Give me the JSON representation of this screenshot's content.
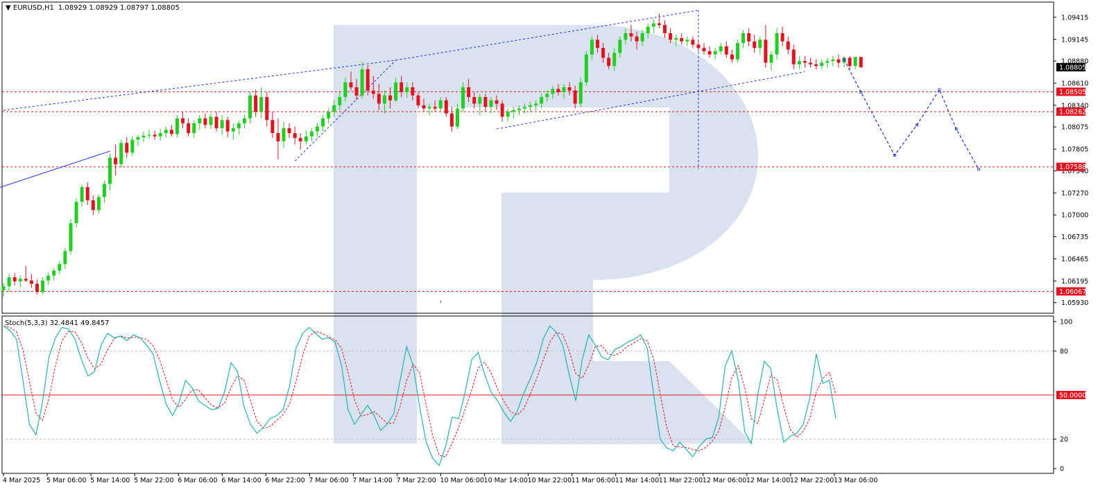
{
  "chart_data": {
    "type": "candlestick",
    "header": {
      "symbol": "EURUSD,H1",
      "values": "1.08929 1.08929 1.08797 1.08805"
    },
    "price_axis": {
      "ylim": [
        1.058,
        1.096
      ],
      "ticks": [
        "1.09415",
        "1.09145",
        "1.08880",
        "1.08610",
        "1.08340",
        "1.08075",
        "1.07805",
        "1.07540",
        "1.07270",
        "1.07000",
        "1.06735",
        "1.06465",
        "1.06195",
        "1.05930"
      ],
      "levels": [
        {
          "price": 1.08805,
          "label": "1.08805",
          "kind": "current"
        },
        {
          "price": 1.08505,
          "label": "1.08505",
          "kind": "level"
        },
        {
          "price": 1.08262,
          "label": "1.08262",
          "kind": "level"
        },
        {
          "price": 1.07588,
          "label": "1.07588",
          "kind": "level"
        },
        {
          "price": 1.06067,
          "label": "1.06067",
          "kind": "level"
        }
      ]
    },
    "time_axis": {
      "labels": [
        "4 Mar 2025",
        "5 Mar 06:00",
        "5 Mar 14:00",
        "5 Mar 22:00",
        "6 Mar 06:00",
        "6 Mar 14:00",
        "6 Mar 22:00",
        "7 Mar 06:00",
        "7 Mar 14:00",
        "7 Mar 22:00",
        "10 Mar 06:00",
        "10 Mar 14:00",
        "10 Mar 22:00",
        "11 Mar 06:00",
        "11 Mar 14:00",
        "11 Mar 22:00",
        "12 Mar 06:00",
        "12 Mar 14:00",
        "12 Mar 22:00",
        "13 Mar 06:00"
      ]
    },
    "candles": [
      [
        1.0608,
        1.0617,
        1.06,
        1.0613
      ],
      [
        1.0613,
        1.0628,
        1.0606,
        1.0624
      ],
      [
        1.0624,
        1.0629,
        1.0614,
        1.0619
      ],
      [
        1.0619,
        1.0626,
        1.0612,
        1.0622
      ],
      [
        1.0622,
        1.0638,
        1.0618,
        1.062
      ],
      [
        1.062,
        1.0628,
        1.0611,
        1.0616
      ],
      [
        1.0616,
        1.0621,
        1.0603,
        1.0606
      ],
      [
        1.0606,
        1.0624,
        1.0603,
        1.062
      ],
      [
        1.062,
        1.063,
        1.0615,
        1.0626
      ],
      [
        1.0626,
        1.0635,
        1.062,
        1.0632
      ],
      [
        1.0632,
        1.0644,
        1.0628,
        1.064
      ],
      [
        1.064,
        1.066,
        1.0634,
        1.0656
      ],
      [
        1.0656,
        1.0695,
        1.0652,
        1.069
      ],
      [
        1.069,
        1.072,
        1.0685,
        1.0716
      ],
      [
        1.0716,
        1.0737,
        1.071,
        1.0734
      ],
      [
        1.0734,
        1.074,
        1.0712,
        1.0718
      ],
      [
        1.0718,
        1.0724,
        1.07,
        1.0706
      ],
      [
        1.0706,
        1.0725,
        1.0702,
        1.0722
      ],
      [
        1.0722,
        1.0742,
        1.0715,
        1.0738
      ],
      [
        1.0738,
        1.0775,
        1.073,
        1.077
      ],
      [
        1.077,
        1.0786,
        1.0748,
        1.0762
      ],
      [
        1.0762,
        1.0792,
        1.0758,
        1.0788
      ],
      [
        1.0788,
        1.0795,
        1.077,
        1.0776
      ],
      [
        1.0776,
        1.0796,
        1.0772,
        1.0792
      ],
      [
        1.0792,
        1.0798,
        1.0784,
        1.0795
      ],
      [
        1.0795,
        1.0802,
        1.0789,
        1.0797
      ],
      [
        1.0797,
        1.0804,
        1.0793,
        1.0798
      ],
      [
        1.0798,
        1.0803,
        1.0792,
        1.0796
      ],
      [
        1.0796,
        1.0805,
        1.0791,
        1.08
      ],
      [
        1.08,
        1.0808,
        1.0795,
        1.0804
      ],
      [
        1.0804,
        1.081,
        1.0796,
        1.0799
      ],
      [
        1.0799,
        1.0822,
        1.0795,
        1.0818
      ],
      [
        1.0818,
        1.0826,
        1.0806,
        1.0812
      ],
      [
        1.0812,
        1.0818,
        1.0796,
        1.08
      ],
      [
        1.08,
        1.0816,
        1.0794,
        1.0812
      ],
      [
        1.0812,
        1.0822,
        1.0804,
        1.0818
      ],
      [
        1.0818,
        1.0824,
        1.0806,
        1.081
      ],
      [
        1.081,
        1.0824,
        1.0805,
        1.082
      ],
      [
        1.082,
        1.0826,
        1.0802,
        1.0806
      ],
      [
        1.0806,
        1.0822,
        1.0798,
        1.0816
      ],
      [
        1.0816,
        1.082,
        1.0795,
        1.0802
      ],
      [
        1.0802,
        1.0812,
        1.0792,
        1.0806
      ],
      [
        1.0806,
        1.0815,
        1.0798,
        1.0812
      ],
      [
        1.0812,
        1.0822,
        1.0806,
        1.0818
      ],
      [
        1.0818,
        1.085,
        1.0812,
        1.0846
      ],
      [
        1.0846,
        1.0853,
        1.082,
        1.0826
      ],
      [
        1.0826,
        1.0856,
        1.0818,
        1.0844
      ],
      [
        1.0844,
        1.085,
        1.0808,
        1.0816
      ],
      [
        1.0816,
        1.0826,
        1.0794,
        1.08
      ],
      [
        1.08,
        1.0818,
        1.0768,
        1.079
      ],
      [
        1.079,
        1.0814,
        1.0782,
        1.0806
      ],
      [
        1.0806,
        1.0812,
        1.0794,
        1.08
      ],
      [
        1.08,
        1.0808,
        1.0786,
        1.0794
      ],
      [
        1.0794,
        1.08,
        1.078,
        1.079
      ],
      [
        1.079,
        1.0803,
        1.0786,
        1.0796
      ],
      [
        1.0796,
        1.0806,
        1.079,
        1.0802
      ],
      [
        1.0802,
        1.0812,
        1.0796,
        1.0808
      ],
      [
        1.0808,
        1.0822,
        1.0802,
        1.0818
      ],
      [
        1.0818,
        1.083,
        1.0812,
        1.0826
      ],
      [
        1.0826,
        1.084,
        1.082,
        1.0834
      ],
      [
        1.0834,
        1.085,
        1.0828,
        1.0844
      ],
      [
        1.0844,
        1.0868,
        1.0838,
        1.0862
      ],
      [
        1.0862,
        1.0875,
        1.0852,
        1.0856
      ],
      [
        1.0856,
        1.0866,
        1.084,
        1.0846
      ],
      [
        1.0846,
        1.0887,
        1.0842,
        1.0878
      ],
      [
        1.0878,
        1.0883,
        1.0846,
        1.0852
      ],
      [
        1.0852,
        1.087,
        1.0842,
        1.0848
      ],
      [
        1.0848,
        1.086,
        1.0828,
        1.0836
      ],
      [
        1.0836,
        1.0852,
        1.0824,
        1.0846
      ],
      [
        1.0846,
        1.0856,
        1.083,
        1.084
      ],
      [
        1.084,
        1.0868,
        1.0838,
        1.0862
      ],
      [
        1.0862,
        1.087,
        1.0844,
        1.085
      ],
      [
        1.085,
        1.0862,
        1.0843,
        1.0856
      ],
      [
        1.0856,
        1.0862,
        1.084,
        1.0846
      ],
      [
        1.0846,
        1.085,
        1.083,
        1.0834
      ],
      [
        1.0834,
        1.0842,
        1.0826,
        1.083
      ],
      [
        1.083,
        1.0836,
        1.0822,
        1.0832
      ],
      [
        1.0832,
        1.084,
        1.0826,
        1.083
      ],
      [
        1.083,
        1.0844,
        1.0826,
        1.084
      ],
      [
        1.084,
        1.0844,
        1.082,
        1.0824
      ],
      [
        1.0824,
        1.0832,
        1.0802,
        1.0808
      ],
      [
        1.0808,
        1.0836,
        1.0805,
        1.083
      ],
      [
        1.083,
        1.0862,
        1.0826,
        1.0856
      ],
      [
        1.0856,
        1.0866,
        1.0838,
        1.0844
      ],
      [
        1.0844,
        1.085,
        1.083,
        1.0836
      ],
      [
        1.0836,
        1.0848,
        1.0822,
        1.0844
      ],
      [
        1.0844,
        1.0848,
        1.0826,
        1.0832
      ],
      [
        1.0832,
        1.0844,
        1.0824,
        1.084
      ],
      [
        1.084,
        1.0846,
        1.0828,
        1.0836
      ],
      [
        1.0836,
        1.084,
        1.0814,
        1.082
      ],
      [
        1.082,
        1.083,
        1.0814,
        1.0826
      ],
      [
        1.0826,
        1.0832,
        1.0818,
        1.0828
      ],
      [
        1.0828,
        1.0834,
        1.0822,
        1.083
      ],
      [
        1.083,
        1.0836,
        1.0824,
        1.0832
      ],
      [
        1.0832,
        1.0838,
        1.0826,
        1.0834
      ],
      [
        1.0834,
        1.084,
        1.0828,
        1.0836
      ],
      [
        1.0836,
        1.0848,
        1.083,
        1.0844
      ],
      [
        1.0844,
        1.0852,
        1.0838,
        1.0848
      ],
      [
        1.0848,
        1.0858,
        1.0842,
        1.0854
      ],
      [
        1.0854,
        1.086,
        1.0846,
        1.085
      ],
      [
        1.085,
        1.086,
        1.0842,
        1.0856
      ],
      [
        1.0856,
        1.0862,
        1.0846,
        1.0852
      ],
      [
        1.0852,
        1.0858,
        1.083,
        1.0836
      ],
      [
        1.0836,
        1.0868,
        1.0832,
        1.0862
      ],
      [
        1.0862,
        1.09,
        1.0858,
        1.0896
      ],
      [
        1.0896,
        1.0918,
        1.089,
        1.0914
      ],
      [
        1.0914,
        1.092,
        1.0898,
        1.0904
      ],
      [
        1.0904,
        1.091,
        1.0886,
        1.0892
      ],
      [
        1.0892,
        1.0898,
        1.0878,
        1.0882
      ],
      [
        1.0882,
        1.0904,
        1.0876,
        1.0898
      ],
      [
        1.0898,
        1.0918,
        1.0892,
        1.0914
      ],
      [
        1.0914,
        1.0928,
        1.0908,
        1.0922
      ],
      [
        1.0922,
        1.0932,
        1.0912,
        1.0918
      ],
      [
        1.0918,
        1.0924,
        1.0902,
        1.0912
      ],
      [
        1.0912,
        1.0926,
        1.0906,
        1.0922
      ],
      [
        1.0922,
        1.0934,
        1.0916,
        1.093
      ],
      [
        1.093,
        1.094,
        1.0922,
        1.0934
      ],
      [
        1.0934,
        1.0946,
        1.0928,
        1.0932
      ],
      [
        1.0932,
        1.0938,
        1.0916,
        1.0922
      ],
      [
        1.0922,
        1.0928,
        1.091,
        1.0914
      ],
      [
        1.0914,
        1.092,
        1.0906,
        1.0916
      ],
      [
        1.0916,
        1.0922,
        1.0908,
        1.0912
      ],
      [
        1.0912,
        1.0918,
        1.0906,
        1.0914
      ],
      [
        1.0914,
        1.0918,
        1.0904,
        1.0908
      ],
      [
        1.0908,
        1.0914,
        1.09,
        1.0904
      ],
      [
        1.0904,
        1.091,
        1.0896,
        1.09
      ],
      [
        1.09,
        1.0906,
        1.0892,
        1.0896
      ],
      [
        1.0896,
        1.0904,
        1.089,
        1.09
      ],
      [
        1.09,
        1.091,
        1.0896,
        1.0906
      ],
      [
        1.0906,
        1.0912,
        1.0892,
        1.0896
      ],
      [
        1.0896,
        1.0902,
        1.0886,
        1.089
      ],
      [
        1.089,
        1.0914,
        1.0886,
        1.091
      ],
      [
        1.091,
        1.0926,
        1.0904,
        1.0922
      ],
      [
        1.0922,
        1.0928,
        1.0906,
        1.0912
      ],
      [
        1.0912,
        1.092,
        1.0898,
        1.0904
      ],
      [
        1.0904,
        1.0918,
        1.0896,
        1.0914
      ],
      [
        1.0914,
        1.0932,
        1.088,
        1.0886
      ],
      [
        1.0886,
        1.09,
        1.0876,
        1.0896
      ],
      [
        1.0896,
        1.0928,
        1.089,
        1.0922
      ],
      [
        1.0922,
        1.093,
        1.0906,
        1.0912
      ],
      [
        1.0912,
        1.0918,
        1.0896,
        1.0902
      ],
      [
        1.0902,
        1.0908,
        1.0878,
        1.0884
      ],
      [
        1.0884,
        1.0894,
        1.0878,
        1.0888
      ],
      [
        1.0888,
        1.0894,
        1.088,
        1.0886
      ],
      [
        1.0886,
        1.0892,
        1.088,
        1.0884
      ],
      [
        1.0884,
        1.089,
        1.0878,
        1.0882
      ],
      [
        1.0882,
        1.089,
        1.0878,
        1.0886
      ],
      [
        1.0886,
        1.0892,
        1.088,
        1.0888
      ],
      [
        1.0888,
        1.0894,
        1.0882,
        1.089
      ],
      [
        1.089,
        1.0896,
        1.088,
        1.0886
      ],
      [
        1.0886,
        1.0894,
        1.088,
        1.0892
      ],
      [
        1.0892,
        1.0894,
        1.0878,
        1.0882
      ],
      [
        1.0882,
        1.0893,
        1.0878,
        1.08929
      ],
      [
        1.08929,
        1.08929,
        1.08797,
        1.08805
      ]
    ],
    "pattern_lines": [
      {
        "style": "dashed",
        "points": [
          [
            0,
            1.0828
          ],
          [
            70,
            1.0889
          ]
        ]
      },
      {
        "style": "dashed",
        "points": [
          [
            70,
            1.0889
          ],
          [
            124,
            1.095
          ]
        ]
      },
      {
        "style": "dashed",
        "points": [
          [
            52,
            1.0766
          ],
          [
            70,
            1.0889
          ]
        ]
      },
      {
        "style": "dashed",
        "points": [
          [
            88,
            1.0805
          ],
          [
            143,
            1.0875
          ]
        ]
      },
      {
        "style": "dashed",
        "points": [
          [
            124,
            1.095
          ],
          [
            124,
            1.0756
          ]
        ]
      },
      {
        "style": "dashed",
        "points": [
          [
            78,
            1.0593
          ],
          [
            78,
            1.0598
          ]
        ]
      },
      {
        "style": "solid",
        "points": [
          [
            -20,
            1.069
          ],
          [
            19,
            1.0778
          ]
        ]
      },
      {
        "style": "solid",
        "points": [
          [
            198,
            1.0736
          ],
          [
            203,
            1.0778
          ]
        ]
      }
    ],
    "forecast": [
      [
        150,
        1.089
      ],
      [
        153,
        1.085
      ],
      [
        159,
        1.0773
      ],
      [
        163,
        1.081
      ],
      [
        167,
        1.0853
      ],
      [
        170,
        1.0805
      ],
      [
        174,
        1.0756
      ]
    ],
    "stochastic": {
      "label": "Stoch(5,3,3) 32.4841 49.8457",
      "ylim": [
        0,
        100
      ],
      "ticks": [
        "100",
        "80",
        "20",
        "0"
      ],
      "level_label": "50.0000",
      "levels": [
        80,
        50,
        20
      ],
      "k": [
        97,
        94,
        88,
        60,
        30,
        23,
        45,
        76,
        89,
        96,
        95,
        88,
        74,
        63,
        66,
        84,
        92,
        89,
        90,
        87,
        91,
        89,
        84,
        78,
        60,
        44,
        36,
        45,
        60,
        55,
        46,
        43,
        40,
        41,
        52,
        72,
        66,
        42,
        30,
        24,
        28,
        34,
        36,
        40,
        56,
        82,
        92,
        96,
        92,
        88,
        89,
        86,
        70,
        40,
        30,
        37,
        43,
        36,
        26,
        30,
        37,
        60,
        83,
        70,
        42,
        18,
        7,
        2,
        15,
        35,
        34,
        52,
        74,
        79,
        64,
        52,
        46,
        38,
        32,
        39,
        51,
        61,
        72,
        88,
        97,
        93,
        84,
        64,
        46,
        74,
        91,
        84,
        76,
        74,
        81,
        83,
        86,
        88,
        91,
        82,
        50,
        20,
        14,
        12,
        18,
        13,
        8,
        15,
        20,
        21,
        35,
        70,
        80,
        60,
        25,
        17,
        50,
        73,
        68,
        40,
        18,
        22,
        24,
        30,
        48,
        78,
        58,
        60,
        34
      ]
    }
  }
}
